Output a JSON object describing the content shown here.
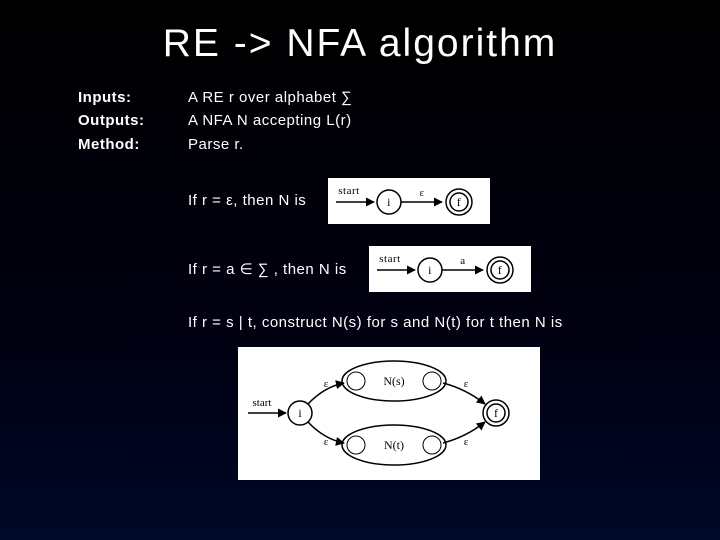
{
  "title": "RE -> NFA algorithm",
  "spec": {
    "inputs_label": "Inputs:",
    "inputs_val": "A RE r over alphabet ∑",
    "outputs_label": "Outputs:",
    "outputs_val": "A NFA N accepting L(r)",
    "method_label": "Method:",
    "method_val": "Parse r."
  },
  "cases": {
    "c1": "If r = ε, then N is",
    "c2": "If r = a ∈ ∑ , then N is",
    "c3": "If r = s | t, construct N(s) for s and N(t) for t then N is"
  },
  "diagram1": {
    "start": "start",
    "i": "i",
    "eps": "ε",
    "f": "f"
  },
  "diagram2": {
    "start": "start",
    "i": "i",
    "a": "a",
    "f": "f"
  },
  "diagram3": {
    "start": "start",
    "i": "i",
    "f": "f",
    "ns": "N(s)",
    "nt": "N(t)",
    "eps": "ε"
  }
}
